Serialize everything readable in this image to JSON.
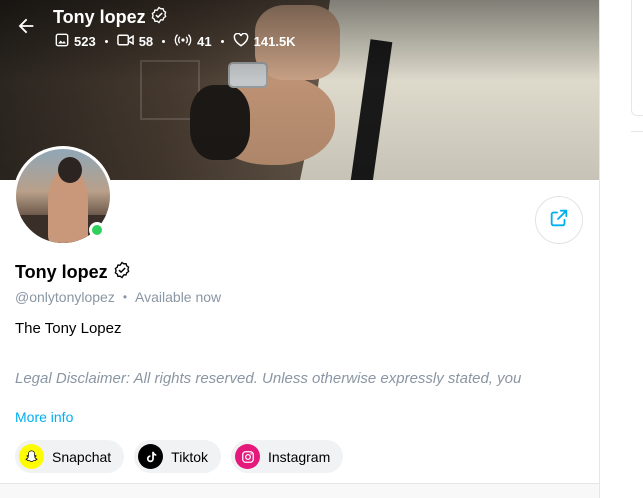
{
  "header": {
    "title": "Tony lopez",
    "stats": [
      {
        "icon": "image-icon",
        "value": "523"
      },
      {
        "icon": "video-icon",
        "value": "58"
      },
      {
        "icon": "broadcast-icon",
        "value": "41"
      },
      {
        "icon": "heart-icon",
        "value": "141.5K"
      }
    ]
  },
  "profile": {
    "name": "Tony lopez",
    "handle": "@onlytonylopez",
    "status": "Available now",
    "bio": "The Tony Lopez",
    "disclaimer": "Legal Disclaimer: All rights reserved. Unless otherwise expressly stated, you",
    "more_info_label": "More info"
  },
  "socials": [
    {
      "icon": "snapchat-icon",
      "label": "Snapchat"
    },
    {
      "icon": "tiktok-icon",
      "label": "Tiktok"
    },
    {
      "icon": "instagram-icon",
      "label": "Instagram"
    }
  ],
  "colors": {
    "accent": "#00aff0",
    "online": "#2fd05c",
    "muted_text": "#8a96a3",
    "snapchat": "#fffc00",
    "tiktok": "#000000",
    "instagram": "#e4197b"
  }
}
